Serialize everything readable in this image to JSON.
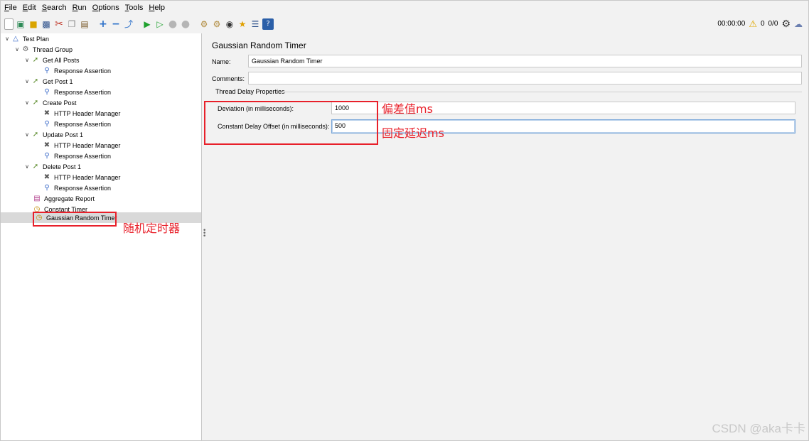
{
  "menu": [
    {
      "mnemonic": "F",
      "rest": "ile"
    },
    {
      "mnemonic": "E",
      "rest": "dit"
    },
    {
      "mnemonic": "S",
      "rest": "earch"
    },
    {
      "mnemonic": "R",
      "rest": "un"
    },
    {
      "mnemonic": "O",
      "rest": "ptions"
    },
    {
      "mnemonic": "T",
      "rest": "ools"
    },
    {
      "mnemonic": "H",
      "rest": "elp"
    }
  ],
  "toolbar": {
    "elapsed": "00:00:00",
    "warning_count": "0",
    "threads": "0/0"
  },
  "tree": {
    "test_plan": "Test Plan",
    "thread_group": "Thread Group",
    "get_all_posts": "Get All Posts",
    "assert_1": "Response Assertion",
    "get_post_1": "Get Post 1",
    "assert_2": "Response Assertion",
    "create_post": "Create Post",
    "header_1": "HTTP Header Manager",
    "assert_3": "Response Assertion",
    "update_post_1": "Update Post 1",
    "header_2": "HTTP Header Manager",
    "assert_4": "Response Assertion",
    "delete_post_1": "Delete Post 1",
    "header_3": "HTTP Header Manager",
    "assert_5": "Response Assertion",
    "aggregate_report": "Aggregate Report",
    "constant_timer": "Constant Timer",
    "gaussian_timer": "Gaussian Random Timer"
  },
  "panel": {
    "title": "Gaussian Random Timer",
    "name_label": "Name:",
    "name_value": "Gaussian Random Timer",
    "comments_label": "Comments:",
    "comments_value": "",
    "group_title": "Thread Delay Properties",
    "deviation_label": "Deviation (in milliseconds):",
    "deviation_value": "1000",
    "offset_label": "Constant Delay Offset (in milliseconds):",
    "offset_value": "500"
  },
  "annotations": {
    "deviation_note": "偏差值ms",
    "offset_note": "固定延迟ms",
    "timer_note": "随机定时器"
  },
  "watermark": "CSDN @aka卡卡",
  "colors": {
    "annotation": "#e8202a",
    "selection": "#d9d9d9",
    "background": "#f2f2f2"
  }
}
